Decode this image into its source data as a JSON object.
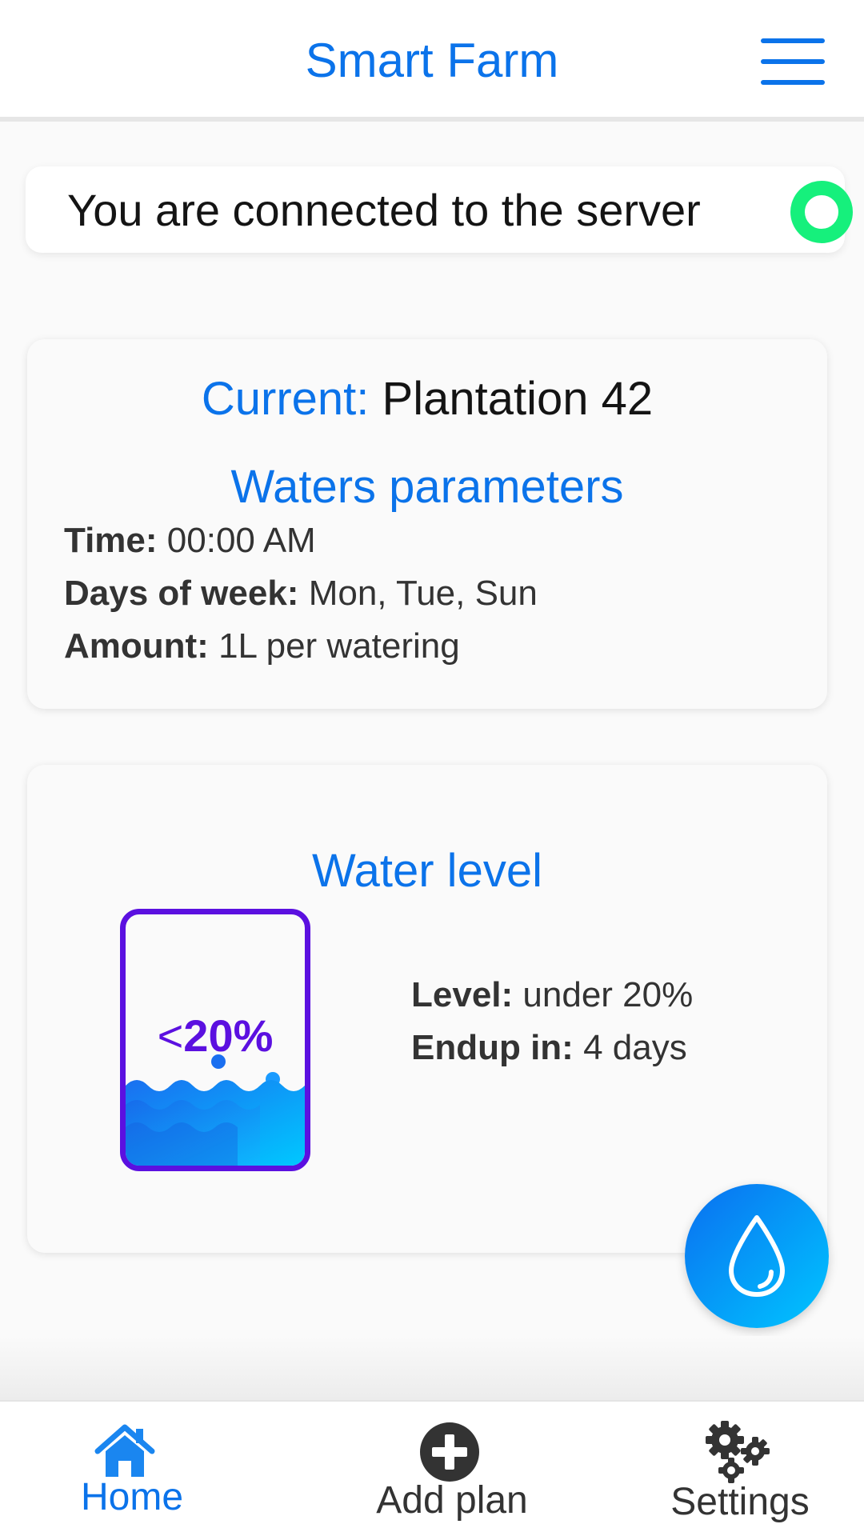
{
  "header": {
    "title": "Smart Farm",
    "menu_icon": "hamburger-menu-icon"
  },
  "connection": {
    "text": "You are connected to the server",
    "status_color": "#16f07c"
  },
  "plan": {
    "current_label": "Current:",
    "current_name": "Plantation 42",
    "section_title": "Waters parameters",
    "params": [
      {
        "label": "Time:",
        "value": "00:00 AM"
      },
      {
        "label": "Days of week:",
        "value": "Mon, Tue, Sun"
      },
      {
        "label": "Amount:",
        "value": "1L per watering"
      }
    ]
  },
  "water": {
    "title": "Water level",
    "tank_label_prefix": "<",
    "tank_label_value": "20%",
    "fill_fraction": 0.28,
    "info": [
      {
        "label": "Level:",
        "value": "under 20%"
      },
      {
        "label": "Endup in:",
        "value": "4 days"
      }
    ]
  },
  "fab": {
    "icon": "water-drop-icon"
  },
  "nav": {
    "items": [
      {
        "label": "Home",
        "icon": "home-icon",
        "active": true
      },
      {
        "label": "Add plan",
        "icon": "plus-circle-icon",
        "active": false
      },
      {
        "label": "Settings",
        "icon": "gears-icon",
        "active": false
      }
    ]
  },
  "colors": {
    "accent": "#0b73ea",
    "tank_border": "#5b10e0",
    "connected": "#16f07c"
  }
}
